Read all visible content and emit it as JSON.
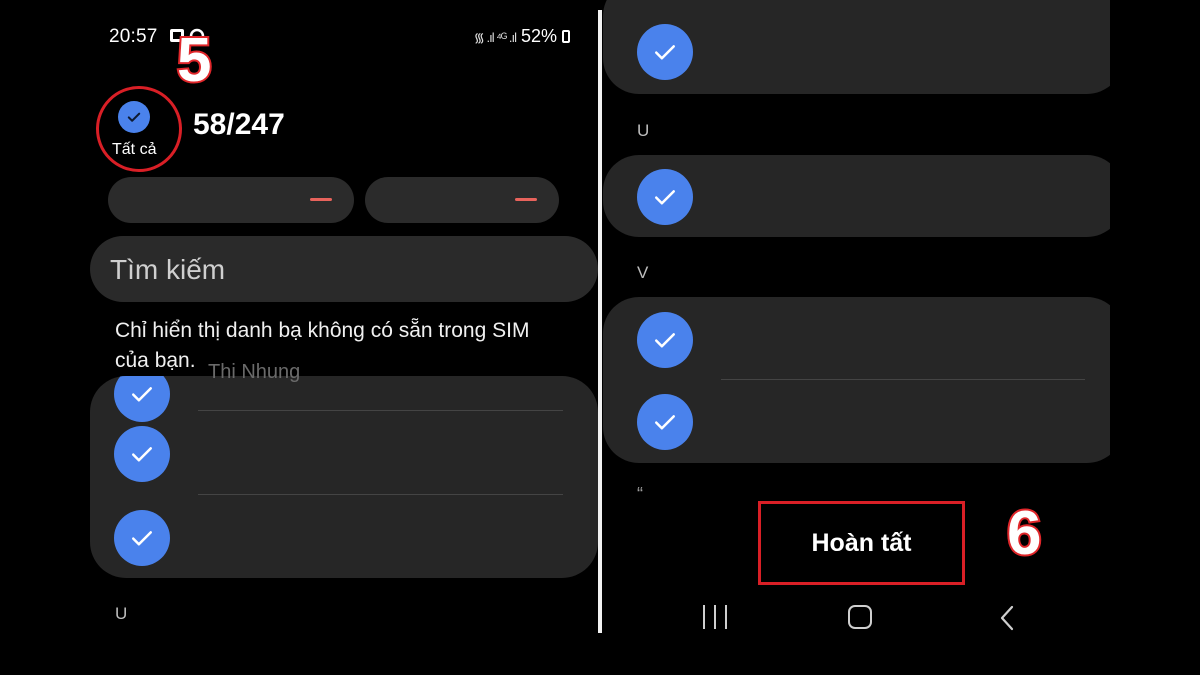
{
  "left_screen": {
    "status_bar": {
      "time": "20:57",
      "battery": "52%",
      "signal_icons": "᯾ .ıl ⁴ᴳ .ıl"
    },
    "annotation_step": "5",
    "select_all_label": "Tất cả",
    "selected_count": "58/247",
    "search_placeholder": "Tìm kiếm",
    "info_text": "Chỉ hiển thị danh bạ không có sẵn trong SIM của bạn.",
    "ghost_contact_name": "Thi Nhung",
    "section_letter": "U"
  },
  "right_screen": {
    "section_letters": [
      "U",
      "V"
    ],
    "trailing_mark": "“",
    "done_button_label": "Hoàn tất",
    "annotation_step": "6"
  },
  "colors": {
    "check_blue": "#4a82ec",
    "annotation_red": "#d91f26",
    "card_bg": "#262626",
    "background": "#000000"
  }
}
